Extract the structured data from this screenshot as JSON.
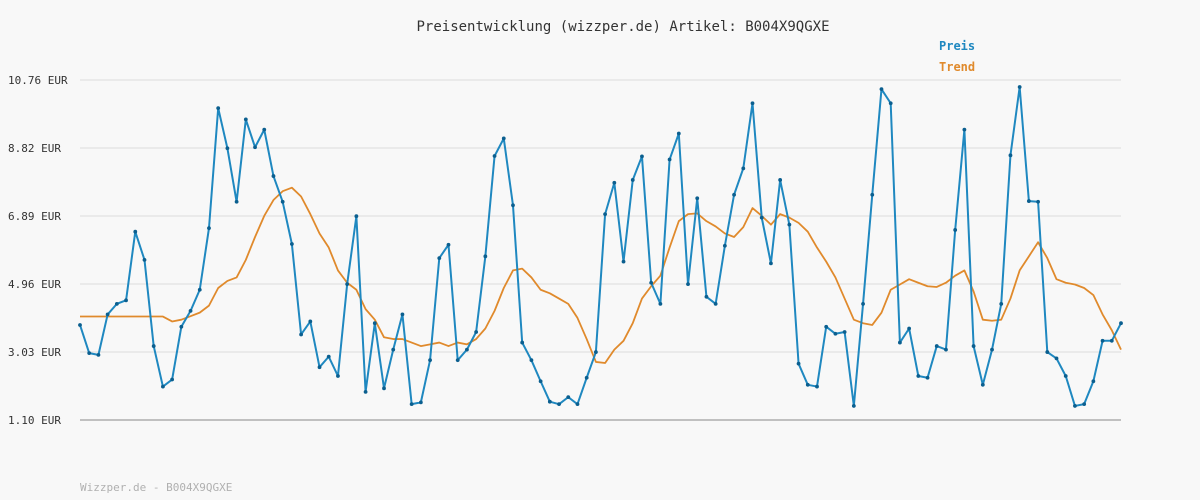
{
  "chart_data": {
    "type": "line",
    "title": "Preisentwicklung (wizzper.de) Artikel: B004X9QGXE",
    "footer": "Wizzper.de - B004X9QGXE",
    "yticks": [
      "10.76 EUR",
      "8.82 EUR",
      "6.89 EUR",
      "4.96 EUR",
      "3.03 EUR",
      "1.10 EUR"
    ],
    "ylim": [
      1.1,
      10.76
    ],
    "grid": true,
    "legend_position": "top-right",
    "series": [
      {
        "name": "Preis",
        "color": "#1f88c0",
        "markers": true,
        "values": [
          3.8,
          3.0,
          2.95,
          4.1,
          4.4,
          4.5,
          6.45,
          5.65,
          3.2,
          2.05,
          2.25,
          3.75,
          4.2,
          4.8,
          6.55,
          9.96,
          8.82,
          7.3,
          9.64,
          8.85,
          9.35,
          8.03,
          7.3,
          6.1,
          3.53,
          3.9,
          2.6,
          2.9,
          2.35,
          4.96,
          6.89,
          1.9,
          3.85,
          2.0,
          3.1,
          4.1,
          1.55,
          1.6,
          2.8,
          5.7,
          6.08,
          2.8,
          3.1,
          3.6,
          5.75,
          8.6,
          9.1,
          7.2,
          3.3,
          2.8,
          2.2,
          1.62,
          1.55,
          1.75,
          1.55,
          2.3,
          3.03,
          6.95,
          7.84,
          5.6,
          7.92,
          8.59,
          5.0,
          4.4,
          8.5,
          9.24,
          4.96,
          7.4,
          4.6,
          4.4,
          6.05,
          7.5,
          8.25,
          10.1,
          6.85,
          5.55,
          7.92,
          6.65,
          2.7,
          2.1,
          2.05,
          3.75,
          3.55,
          3.6,
          1.5,
          4.4,
          7.5,
          10.5,
          10.1,
          3.3,
          3.7,
          2.35,
          2.3,
          3.2,
          3.1,
          6.5,
          9.35,
          3.2,
          2.1,
          3.1,
          4.4,
          8.62,
          10.56,
          7.32,
          7.3,
          3.03,
          2.85,
          2.35,
          1.5,
          1.55,
          2.2,
          3.35,
          3.35,
          3.85
        ],
        "trend_label": ""
      },
      {
        "name": "Trend",
        "color": "#e08a2c",
        "markers": false,
        "values": [
          4.04,
          4.04,
          4.04,
          4.04,
          4.04,
          4.04,
          4.04,
          4.04,
          4.04,
          4.04,
          3.9,
          3.95,
          4.05,
          4.15,
          4.35,
          4.85,
          5.05,
          5.15,
          5.65,
          6.3,
          6.9,
          7.35,
          7.6,
          7.7,
          7.45,
          6.95,
          6.4,
          6.0,
          5.35,
          5.0,
          4.8,
          4.25,
          3.95,
          3.45,
          3.4,
          3.4,
          3.3,
          3.2,
          3.25,
          3.3,
          3.2,
          3.3,
          3.25,
          3.4,
          3.7,
          4.2,
          4.85,
          5.35,
          5.4,
          5.15,
          4.8,
          4.7,
          4.55,
          4.4,
          4.0,
          3.4,
          2.75,
          2.72,
          3.1,
          3.35,
          3.85,
          4.55,
          4.9,
          5.2,
          6.0,
          6.75,
          6.95,
          6.97,
          6.75,
          6.6,
          6.4,
          6.3,
          6.58,
          7.12,
          6.9,
          6.65,
          6.95,
          6.85,
          6.7,
          6.45,
          6.0,
          5.6,
          5.15,
          4.55,
          3.95,
          3.85,
          3.8,
          4.15,
          4.8,
          4.95,
          5.1,
          5.0,
          4.9,
          4.88,
          5.0,
          5.2,
          5.35,
          4.75,
          3.95,
          3.92,
          3.95,
          4.55,
          5.35,
          5.75,
          6.15,
          5.7,
          5.1,
          5.0,
          4.95,
          4.85,
          4.65,
          4.1,
          3.65,
          3.1
        ]
      }
    ]
  }
}
